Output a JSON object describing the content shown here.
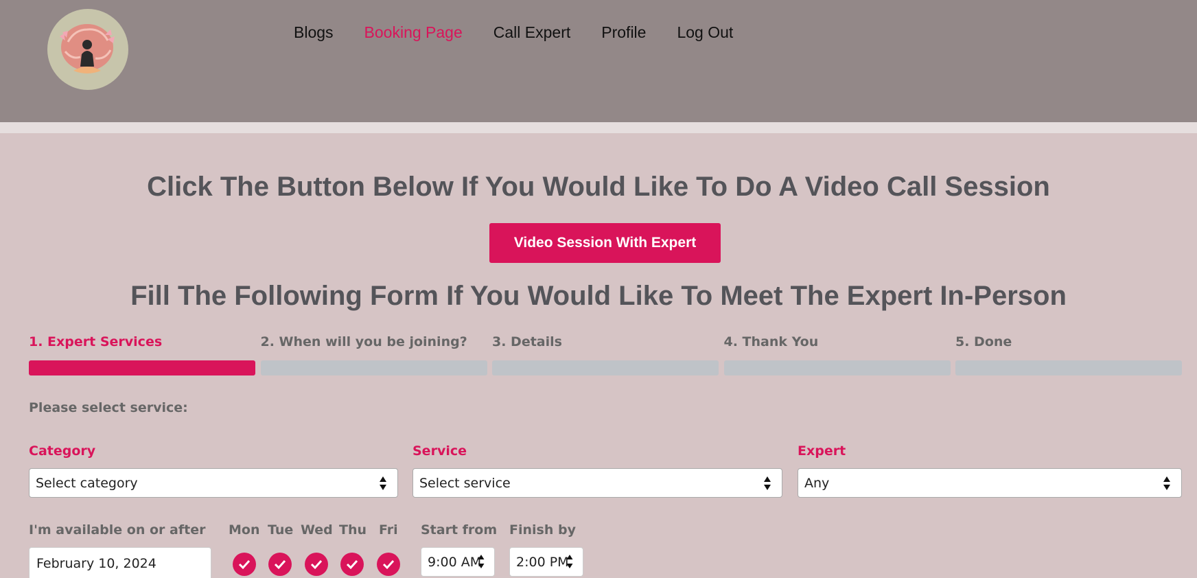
{
  "nav": {
    "items": [
      {
        "label": "Blogs",
        "active": false
      },
      {
        "label": "Booking Page",
        "active": true
      },
      {
        "label": "Call Expert",
        "active": false
      },
      {
        "label": "Profile",
        "active": false
      },
      {
        "label": "Log Out",
        "active": false
      }
    ]
  },
  "main": {
    "video_heading": "Click The Button Below If You Would Like To Do A Video Call Session",
    "video_button": "Video Session With Expert",
    "form_heading": "Fill The Following Form If You Would Like To Meet The Expert In-Person"
  },
  "steps": [
    {
      "label": "1. Expert Services",
      "active": true
    },
    {
      "label": "2. When will you be joining?",
      "active": false
    },
    {
      "label": "3. Details",
      "active": false
    },
    {
      "label": "4. Thank You",
      "active": false
    },
    {
      "label": "5. Done",
      "active": false
    }
  ],
  "form": {
    "prompt": "Please select service:",
    "category_label": "Category",
    "category_value": "Select category",
    "service_label": "Service",
    "service_value": "Select service",
    "expert_label": "Expert",
    "expert_value": "Any",
    "available_label": "I'm available on or after",
    "date_value": "February 10, 2024",
    "days": [
      {
        "label": "Mon",
        "checked": true
      },
      {
        "label": "Tue",
        "checked": true
      },
      {
        "label": "Wed",
        "checked": true
      },
      {
        "label": "Thu",
        "checked": true
      },
      {
        "label": "Fri",
        "checked": true
      }
    ],
    "start_label": "Start from",
    "start_value": "9:00 AM",
    "finish_label": "Finish by",
    "finish_value": "2:00 PM"
  },
  "colors": {
    "accent": "#d9145a",
    "header_bg": "#938888",
    "page_bg": "#d6c4c5",
    "heading_text": "#545459",
    "inactive_bar": "#bfc3c8"
  },
  "icons": {
    "logo": "meditation-brain-logo",
    "select_arrows": "up-down-arrows-icon",
    "day_check": "checkmark-icon"
  }
}
